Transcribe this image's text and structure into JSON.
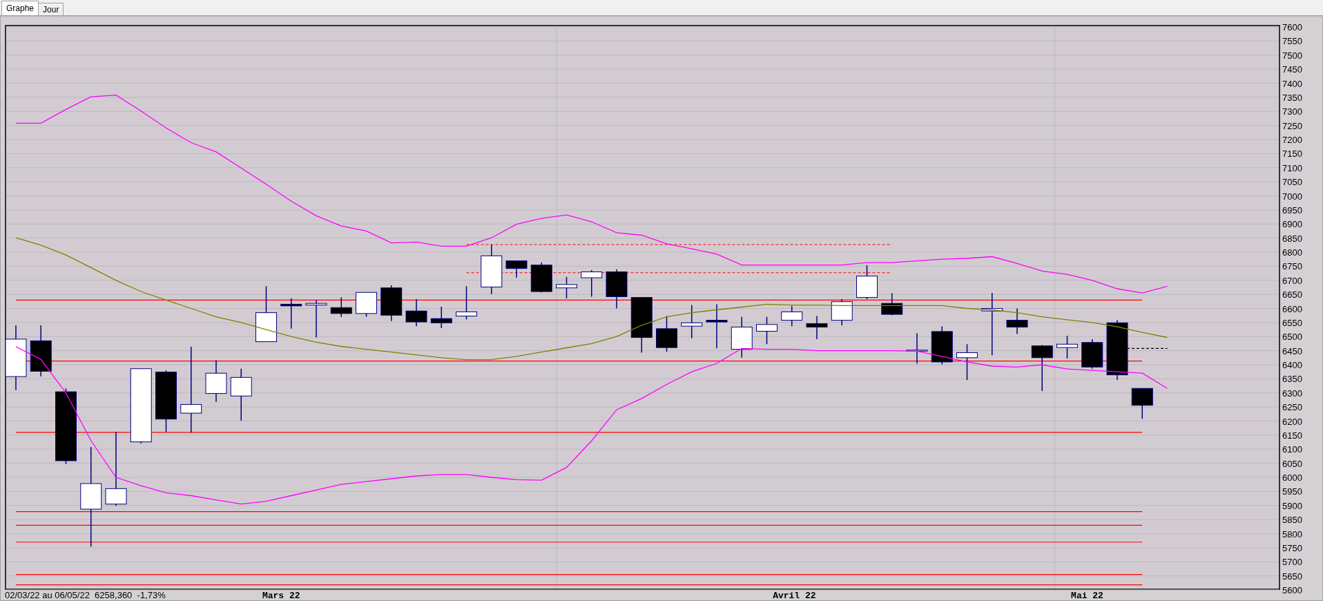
{
  "tabs": [
    {
      "label": "Graphe",
      "selected": true
    },
    {
      "label": "Jour",
      "selected": false
    }
  ],
  "chart": {
    "y_axis_labels": [
      "7600",
      "7550",
      "7500",
      "7450",
      "7400",
      "7350",
      "7300",
      "7250",
      "7200",
      "7150",
      "7100",
      "7050",
      "7000",
      "6950",
      "6900",
      "6850",
      "6800",
      "6750",
      "6700",
      "6650",
      "6600",
      "6550",
      "6500",
      "6450",
      "6400",
      "6350",
      "6300",
      "6250",
      "6200",
      "6150",
      "6100",
      "6050",
      "6000",
      "5950",
      "5900",
      "5850",
      "5800",
      "5750",
      "5700",
      "5650",
      "5600"
    ],
    "summary": "02/03/22 au 06/05/22  6258,360  -1,73%",
    "month_labels": [
      "Mars 22",
      "Avril 22",
      "Mai 22"
    ]
  }
}
